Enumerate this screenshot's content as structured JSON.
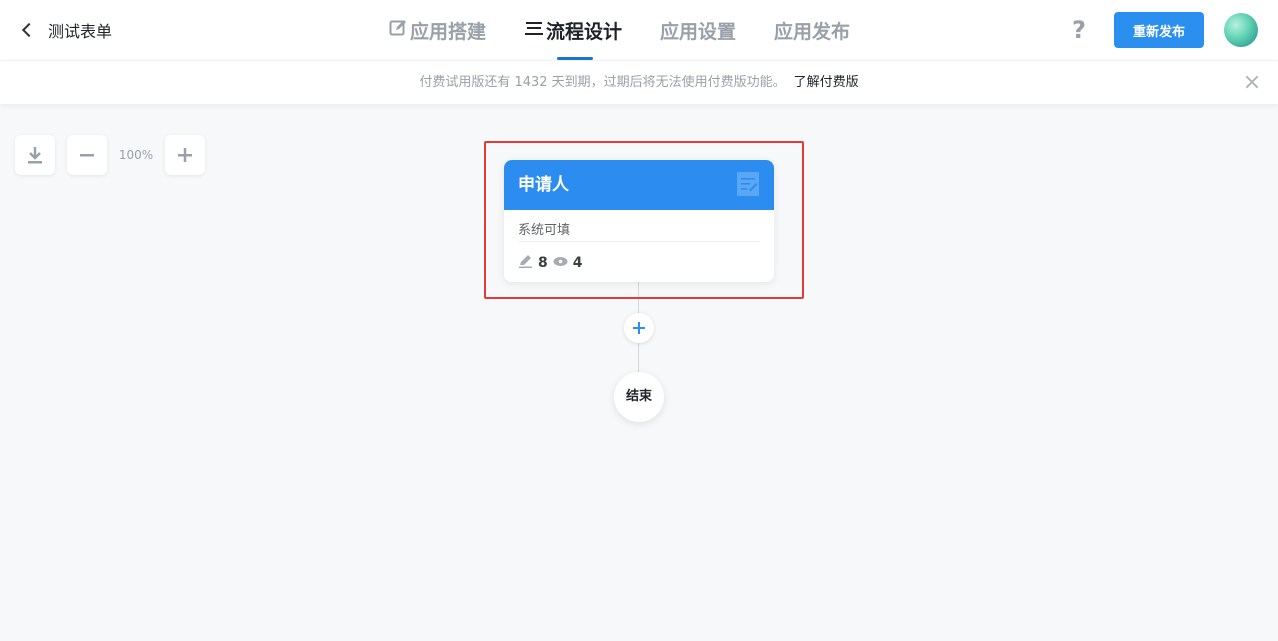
{
  "header": {
    "back_label": "测试表单",
    "tabs": [
      {
        "label": "应用搭建",
        "icon": "edit-icon",
        "active": false
      },
      {
        "label": "流程设计",
        "icon": "flow-icon",
        "active": true
      },
      {
        "label": "应用设置",
        "active": false
      },
      {
        "label": "应用发布",
        "active": false
      }
    ],
    "help_label": "?",
    "republish_label": "重新发布",
    "accent_color": "#2b8ff0"
  },
  "notice": {
    "message": "付费试用版还有 1432 天到期，过期后将无法使用付费版功能。",
    "link_label": "了解付费版"
  },
  "canvas": {
    "zoom": "100%",
    "node": {
      "title": "申请人",
      "subtitle": "系统可填",
      "edit_count": "8",
      "view_count": "4",
      "header_color": "#2d8cf0",
      "highlight_color": "#e43b36"
    },
    "end_label": "结束"
  }
}
